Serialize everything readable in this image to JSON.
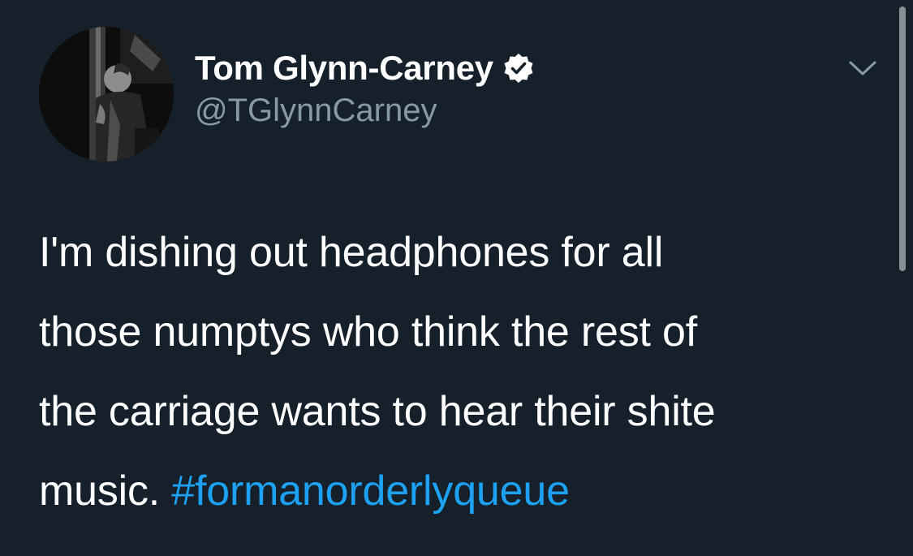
{
  "author": {
    "display_name": "Tom Glynn-Carney",
    "handle": "@TGlynnCarney",
    "verified": true,
    "avatar_icon": "avatar-photo",
    "verified_icon": "verified-badge-icon"
  },
  "menu": {
    "icon": "chevron-down-icon"
  },
  "tweet": {
    "lines": [
      "I'm dishing out headphones for all",
      "those numptys who think the rest of",
      "the carriage wants to hear their shite",
      "music. "
    ],
    "hashtag": "#formanorderlyqueue"
  },
  "colors": {
    "background": "#15202b",
    "text": "#ffffff",
    "secondary_text": "#8899a6",
    "link": "#1da1f2"
  }
}
